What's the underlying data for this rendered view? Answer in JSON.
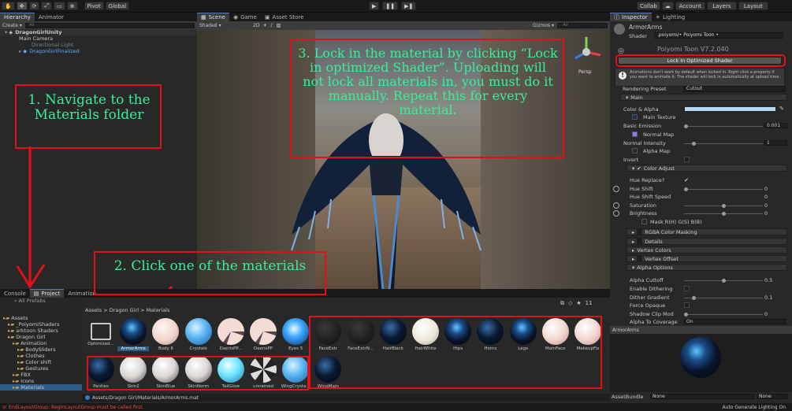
{
  "toolbar": {
    "pivot": "Pivot",
    "global": "Global",
    "collab": "Collab",
    "account": "Account",
    "layers": "Layers",
    "layout": "Layout"
  },
  "hierarchy": {
    "tabs": [
      "Hierarchy",
      "Animator"
    ],
    "search_placeholder": "All",
    "items": [
      "DragonGirlUnity",
      "Main Camera",
      "Directional Light",
      "DragonGirlFinalized"
    ]
  },
  "scene": {
    "tabs": [
      "Scene",
      "Game",
      "Asset Store"
    ],
    "shading": "Shaded",
    "mode2d": "2D",
    "gizmos": "Gizmos",
    "search": "All",
    "persp": "Persp"
  },
  "inspector": {
    "tabs": [
      "Inspector",
      "Lighting"
    ],
    "object_name": "ArmorArms",
    "shader_label": "Shader",
    "shader_value": ".poiyomi/• Poiyomi Toon •",
    "title_obscured": "Poiyomi Toon V7.2.040",
    "lock_button": "Lock In Optimized Shader",
    "warning_text": "Animations don't work by default when locked in. Right click a property if you want to animate it. The shader will lock in automatically at upload time.",
    "rendering_preset_label": "Rendering Preset",
    "rendering_preset_value": "Cutout",
    "main_section": "Main",
    "color_alpha": "Color & Alpha",
    "main_texture": "Main Texture",
    "basic_emission": "Basic Emission",
    "basic_emission_value": "0.001",
    "normal_map": "Normal Map",
    "normal_intensity": "Normal Intensity",
    "normal_intensity_value": "1",
    "alpha_map": "Alpha Map",
    "invert": "Invert",
    "color_adjust": "Color Adjust",
    "hue_replace": "Hue Replace?",
    "hue_shift": "Hue Shift",
    "hue_shift_value": "0",
    "hue_shift_speed": "Hue Shift Speed",
    "hue_shift_speed_value": "0",
    "saturation": "Saturation",
    "saturation_value": "0",
    "brightness": "Brightness",
    "brightness_value": "0",
    "mask": "Mask R(H) G(S) B(B)",
    "rgba_color_masking": "RGBA Color Masking",
    "details": "Details",
    "vertex_colors": "Vertex Colors",
    "vertex_offset": "Vertex Offset",
    "alpha_options": "Alpha Options",
    "alpha_cuttoff": "Alpha Cuttoff",
    "alpha_cuttoff_value": "0.5",
    "enable_dithering": "Enable Dithering",
    "dither_gradient": "Dither Gradient",
    "dither_gradient_value": "0.1",
    "force_opaque": "Force Opaque",
    "shadow_clip_mod": "Shadow Clip Mod",
    "shadow_clip_mod_value": "0",
    "alpha_to_coverage": "Alpha To Coverage",
    "alpha_to_coverage_value": "On",
    "preview_title": "ArmorArms",
    "asset_bundle_label": "AssetBundle",
    "asset_bundle_value": "None",
    "asset_bundle_variant": "None"
  },
  "project": {
    "tabs": [
      "Console",
      "Project",
      "Animation"
    ],
    "search_placeholder": "",
    "breadcrumb": "Assets > Dragon Girl > Materials",
    "favorites_item": "All Prefabs",
    "tree": [
      {
        "label": "Assets",
        "indent": 0
      },
      {
        "label": "_PoiyomiShaders",
        "indent": 1
      },
      {
        "label": "arktoon Shaders",
        "indent": 1
      },
      {
        "label": "Dragon Girl",
        "indent": 1
      },
      {
        "label": "Animation",
        "indent": 2
      },
      {
        "label": "BodySliders",
        "indent": 3
      },
      {
        "label": "Clothes",
        "indent": 3
      },
      {
        "label": "Color shift",
        "indent": 3
      },
      {
        "label": "Gestures",
        "indent": 3
      },
      {
        "label": "FBX",
        "indent": 2
      },
      {
        "label": "Icons",
        "indent": 2
      },
      {
        "label": "Materials",
        "indent": 2
      }
    ],
    "materials": [
      {
        "name": "Optimized...",
        "kind": "folder"
      },
      {
        "name": "ArmorArms",
        "kind": "armor"
      },
      {
        "name": "Body 6",
        "kind": "skin"
      },
      {
        "name": "Crystals",
        "kind": "crystal"
      },
      {
        "name": "DaerisPP...",
        "kind": "pattern"
      },
      {
        "name": "DaerisPP",
        "kind": "pattern"
      },
      {
        "name": "Eyes 5",
        "kind": "eye"
      },
      {
        "name": "FaceExtr",
        "kind": "grey"
      },
      {
        "name": "FaceExtrN...",
        "kind": "grey"
      },
      {
        "name": "HairBlack",
        "kind": "dark"
      },
      {
        "name": "HairWhite",
        "kind": "white"
      },
      {
        "name": "Hips",
        "kind": "armor"
      },
      {
        "name": "Horns",
        "kind": "dark"
      },
      {
        "name": "Legs",
        "kind": "armor"
      },
      {
        "name": "MainFace",
        "kind": "skin2"
      },
      {
        "name": "MakeupFix",
        "kind": "skin2"
      },
      {
        "name": "Panties",
        "kind": "dark"
      },
      {
        "name": "Skin2",
        "kind": "skin3"
      },
      {
        "name": "SkinBlue",
        "kind": "skin3"
      },
      {
        "name": "SkinNorm",
        "kind": "skin3"
      },
      {
        "name": "TailGlow",
        "kind": "glow"
      },
      {
        "name": "unnamed",
        "kind": "noise"
      },
      {
        "name": "WingCrysta...",
        "kind": "crystal"
      },
      {
        "name": "WingMain",
        "kind": "dark"
      }
    ],
    "path": "Assets/Dragon Girl/Materials/ArmorArms.mat",
    "count": "11"
  },
  "status": {
    "error": "EndLayoutGroup: BeginLayoutGroup must be called first.",
    "right": "Auto Generate Lighting On"
  },
  "annotations": {
    "step1": "1. Navigate to the Materials folder",
    "step2": "2. Click one of the materials",
    "step3": "3. Lock in the material by clicking “Lock in optimized Shader”. Uploading will not lock all materials in, you must do it manually. Repeat this for every material."
  },
  "colors": {
    "annotation_red": "#e3101a",
    "annotation_text": "#35f09a",
    "accent_blue": "#4c7fcf",
    "selection": "#2c5d87"
  }
}
